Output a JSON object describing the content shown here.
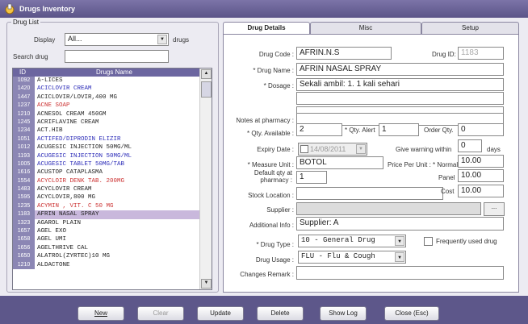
{
  "window": {
    "title": "Drugs Inventory"
  },
  "left": {
    "group_label": "Drug List",
    "display_label": "Display",
    "display_value": "All...",
    "display_suffix": "drugs",
    "search_label": "Search drug",
    "search_value": "",
    "columns": [
      "ID",
      "Drugs Name"
    ],
    "rows": [
      {
        "id": "1092",
        "name": "A-LICES",
        "color": "#222",
        "hl": false
      },
      {
        "id": "1420",
        "name": "ACICLOVIR  CREAM",
        "color": "#2b2bb8",
        "hl": false
      },
      {
        "id": "1447",
        "name": "ACICLOVIR/LOVIR,400 MG",
        "color": "#222",
        "hl": false
      },
      {
        "id": "1237",
        "name": "ACNE SOAP",
        "color": "#cc3333",
        "hl": false
      },
      {
        "id": "1210",
        "name": "ACNESOL CREAM 450GM",
        "color": "#222",
        "hl": false
      },
      {
        "id": "1245",
        "name": "ACRIFLAVINE  CREAM",
        "color": "#222",
        "hl": false
      },
      {
        "id": "1234",
        "name": "ACT.HIB",
        "color": "#222",
        "hl": false
      },
      {
        "id": "1051",
        "name": "ACTIFED/DIPRODIN ELIZIR",
        "color": "#2b2bb8",
        "hl": false
      },
      {
        "id": "1012",
        "name": "ACUGESIC INJECTION 50MG/ML",
        "color": "#222",
        "hl": false
      },
      {
        "id": "1193",
        "name": "ACUGESIC INJECTION 50MG/ML",
        "color": "#2b2bb8",
        "hl": false
      },
      {
        "id": "1005",
        "name": "ACUGESIC TABLET 50MG/TAB",
        "color": "#2b2bb8",
        "hl": false
      },
      {
        "id": "1616",
        "name": "ACUSTOP CATAPLASMA",
        "color": "#222",
        "hl": false
      },
      {
        "id": "1554",
        "name": "ACYCLOIR DENK TAB. 200MG",
        "color": "#cc3333",
        "hl": false
      },
      {
        "id": "1483",
        "name": "ACYCLOVIR CREAM",
        "color": "#222",
        "hl": false
      },
      {
        "id": "1595",
        "name": "ACYCLOVIR,800 MG",
        "color": "#222",
        "hl": false
      },
      {
        "id": "1235",
        "name": "ACYMIN , VIT. C 50 MG",
        "color": "#cc3333",
        "hl": false
      },
      {
        "id": "1183",
        "name": "AFRIN NASAL SPRAY",
        "color": "#222",
        "hl": true
      },
      {
        "id": "1323",
        "name": "AGAROL  PLAIN",
        "color": "#222",
        "hl": false
      },
      {
        "id": "1657",
        "name": "AGEL EXO",
        "color": "#222",
        "hl": false
      },
      {
        "id": "1658",
        "name": "AGEL UMI",
        "color": "#222",
        "hl": false
      },
      {
        "id": "1656",
        "name": "AGELTHRIVE CAL",
        "color": "#222",
        "hl": false
      },
      {
        "id": "1650",
        "name": "ALATROL(ZYRTEC)10 MG",
        "color": "#222",
        "hl": false
      },
      {
        "id": "1210",
        "name": "ALDACTONE",
        "color": "#222",
        "hl": false
      }
    ]
  },
  "tabs": [
    "Drug Details",
    "Misc",
    "Setup"
  ],
  "form": {
    "drug_code_label": "Drug Code :",
    "drug_code": "AFRIN.N.S",
    "drug_id_label": "Drug ID:",
    "drug_id": "1183",
    "drug_name_label": "* Drug Name :",
    "drug_name": "AFRIN NASAL SPRAY",
    "dosage_label": "* Dosage :",
    "dosage": "Sekali ambil: 1. 1 kali sehari",
    "notes_label": "Notes at pharmacy :",
    "qty_available_label": "* Qty. Available :",
    "qty_available": "2",
    "qty_alert_label": "* Qty. Alert",
    "qty_alert": "1",
    "order_qty_label": "Order Qty.",
    "order_qty": "0",
    "expiry_label": "Expiry Date :",
    "expiry": "14/08/2011",
    "give_warning_label": "Give warning within",
    "give_warning": "0",
    "days_label": "days",
    "measure_unit_label": "* Measure Unit :",
    "measure_unit": "BOTOL",
    "price_label": "Price Per Unit : * Normal",
    "price_normal": "10.00",
    "default_qty_label": "Default qty at pharmacy :",
    "default_qty": "1",
    "panel_label": "Panel",
    "price_panel": "10.00",
    "cost_label": "Cost",
    "cost": "10.00",
    "stock_location_label": "Stock Location :",
    "supplier_label": "Supplier :",
    "supplier_btn": "...",
    "additional_label": "Additional Info :",
    "additional": "Supplier: A",
    "drug_type_label": "* Drug Type :",
    "drug_type": "10 - General Drug",
    "frequent_label": "Frequently used drug",
    "drug_usage_label": "Drug Usage :",
    "drug_usage": "FLU - Flu & Cough",
    "changes_label": "Changes Remark :"
  },
  "buttons": {
    "new": "New",
    "clear": "Clear",
    "update": "Update",
    "delete": "Delete",
    "show_log": "Show Log",
    "close": "Close (Esc)"
  }
}
